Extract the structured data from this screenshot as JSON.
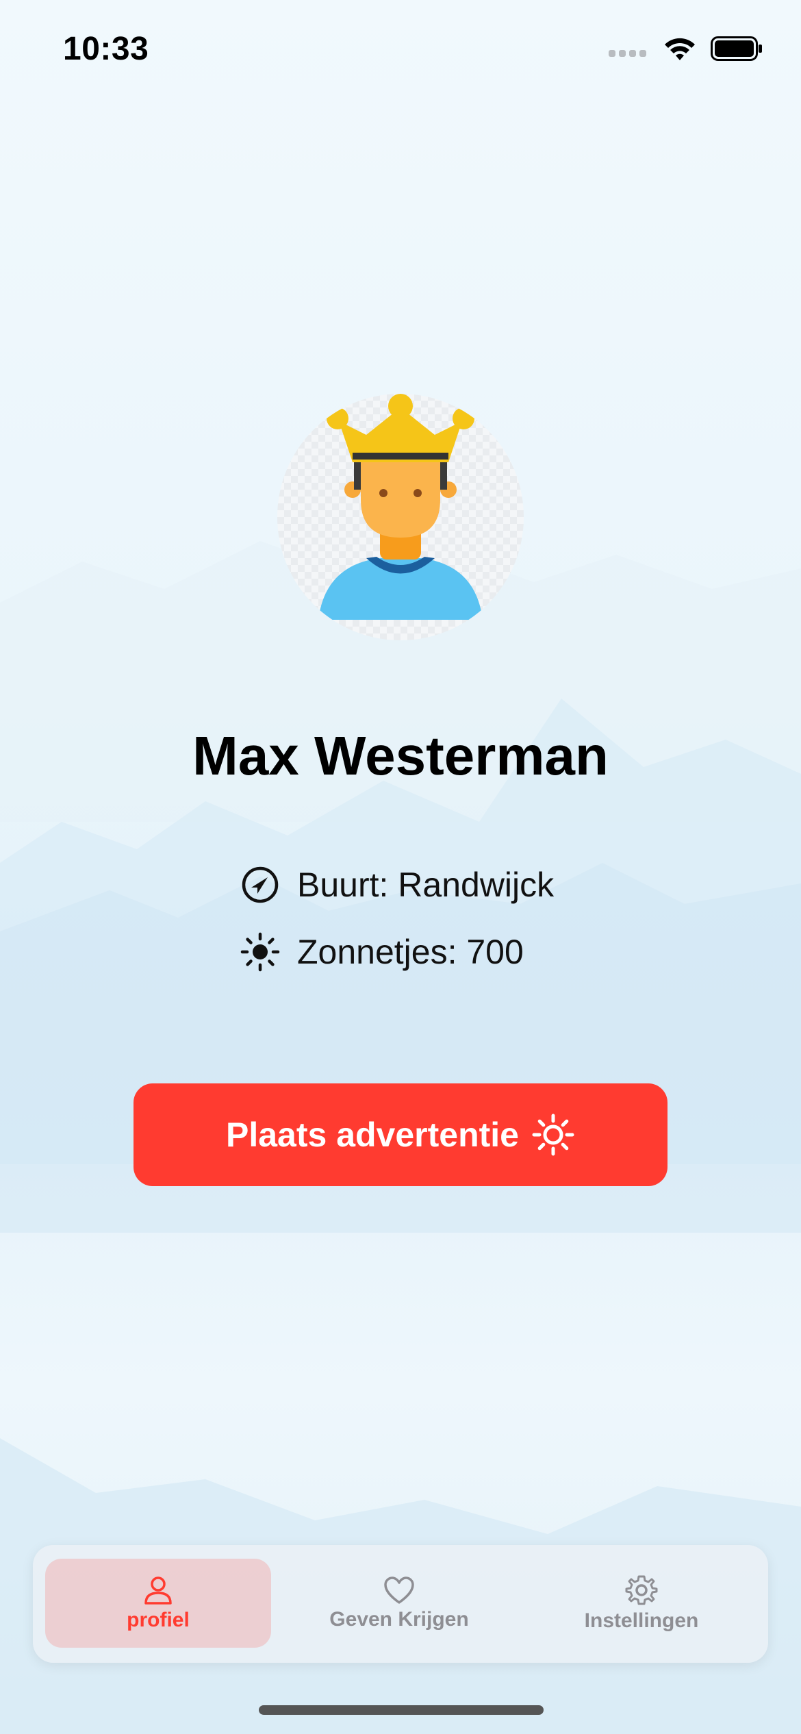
{
  "status_bar": {
    "time": "10:33"
  },
  "profile": {
    "name": "Max Westerman",
    "buurt": "Buurt: Randwijck",
    "zonnetjes": "Zonnetjes: 700"
  },
  "cta": {
    "label": "Plaats advertentie"
  },
  "tab_bar": {
    "tabs": [
      {
        "label": "profiel",
        "icon": "person-icon",
        "active": true
      },
      {
        "label": "Geven Krijgen",
        "icon": "heart-icon",
        "active": false
      },
      {
        "label": "Instellingen",
        "icon": "gear-icon",
        "active": false
      }
    ]
  },
  "colors": {
    "accent": "#ff3b30",
    "inactive": "#8e8e93"
  }
}
